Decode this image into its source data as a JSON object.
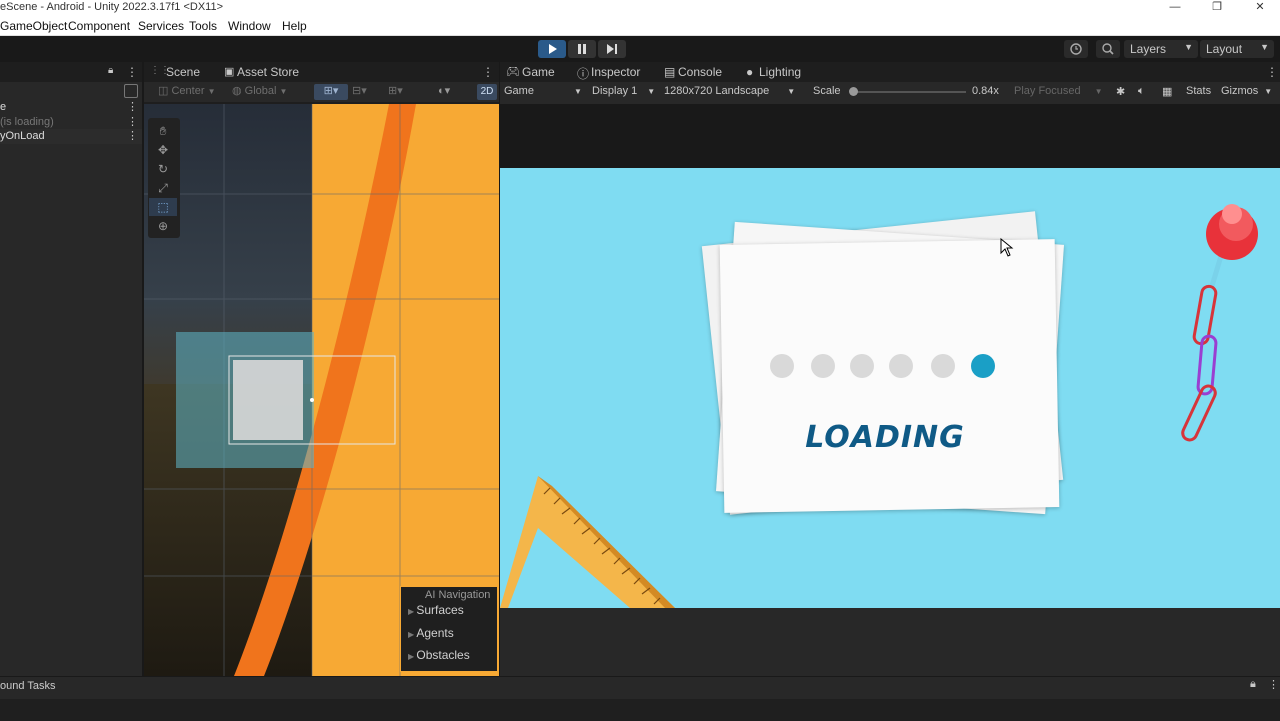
{
  "window": {
    "title": "eScene - Android - Unity 2022.3.17f1 <DX11>",
    "minimize": "—",
    "maximize": "❐",
    "close": "✕"
  },
  "menu": [
    "GameObject",
    "Component",
    "Services",
    "Tools",
    "Window",
    "Help"
  ],
  "toolbar": {
    "play_icon": "play-icon",
    "pause_icon": "pause-icon",
    "step_icon": "step-icon",
    "layers": "Layers",
    "layout": "Layout"
  },
  "hierarchy": {
    "items": [
      "e",
      "(is loading)",
      "yOnLoad"
    ]
  },
  "scene_panel": {
    "tabs": [
      "Scene",
      "Asset Store"
    ],
    "pivot": "Center",
    "space": "Global",
    "mode_2d": "2D",
    "ai_navigation": {
      "title": "AI Navigation",
      "items": [
        "Surfaces",
        "Agents",
        "Obstacles"
      ]
    }
  },
  "game_panel": {
    "tabs": [
      "Game",
      "Inspector",
      "Console",
      "Lighting"
    ],
    "view": "Game",
    "display": "Display 1",
    "resolution": "1280x720 Landscape",
    "scale_label": "Scale",
    "scale_value": "0.84x",
    "play_focused": "Play Focused",
    "stats": "Stats",
    "gizmos": "Gizmos",
    "loading_text": "LOADING",
    "dots_total": 6,
    "active_dot": 6
  },
  "bottom": {
    "background_tasks": "ound Tasks"
  },
  "colors": {
    "sky": "#7fdcf2",
    "accent_dot": "#1a9fc6",
    "loading_text": "#0f5a86",
    "orange": "#f7a934",
    "ruler": "#f4b64a"
  }
}
